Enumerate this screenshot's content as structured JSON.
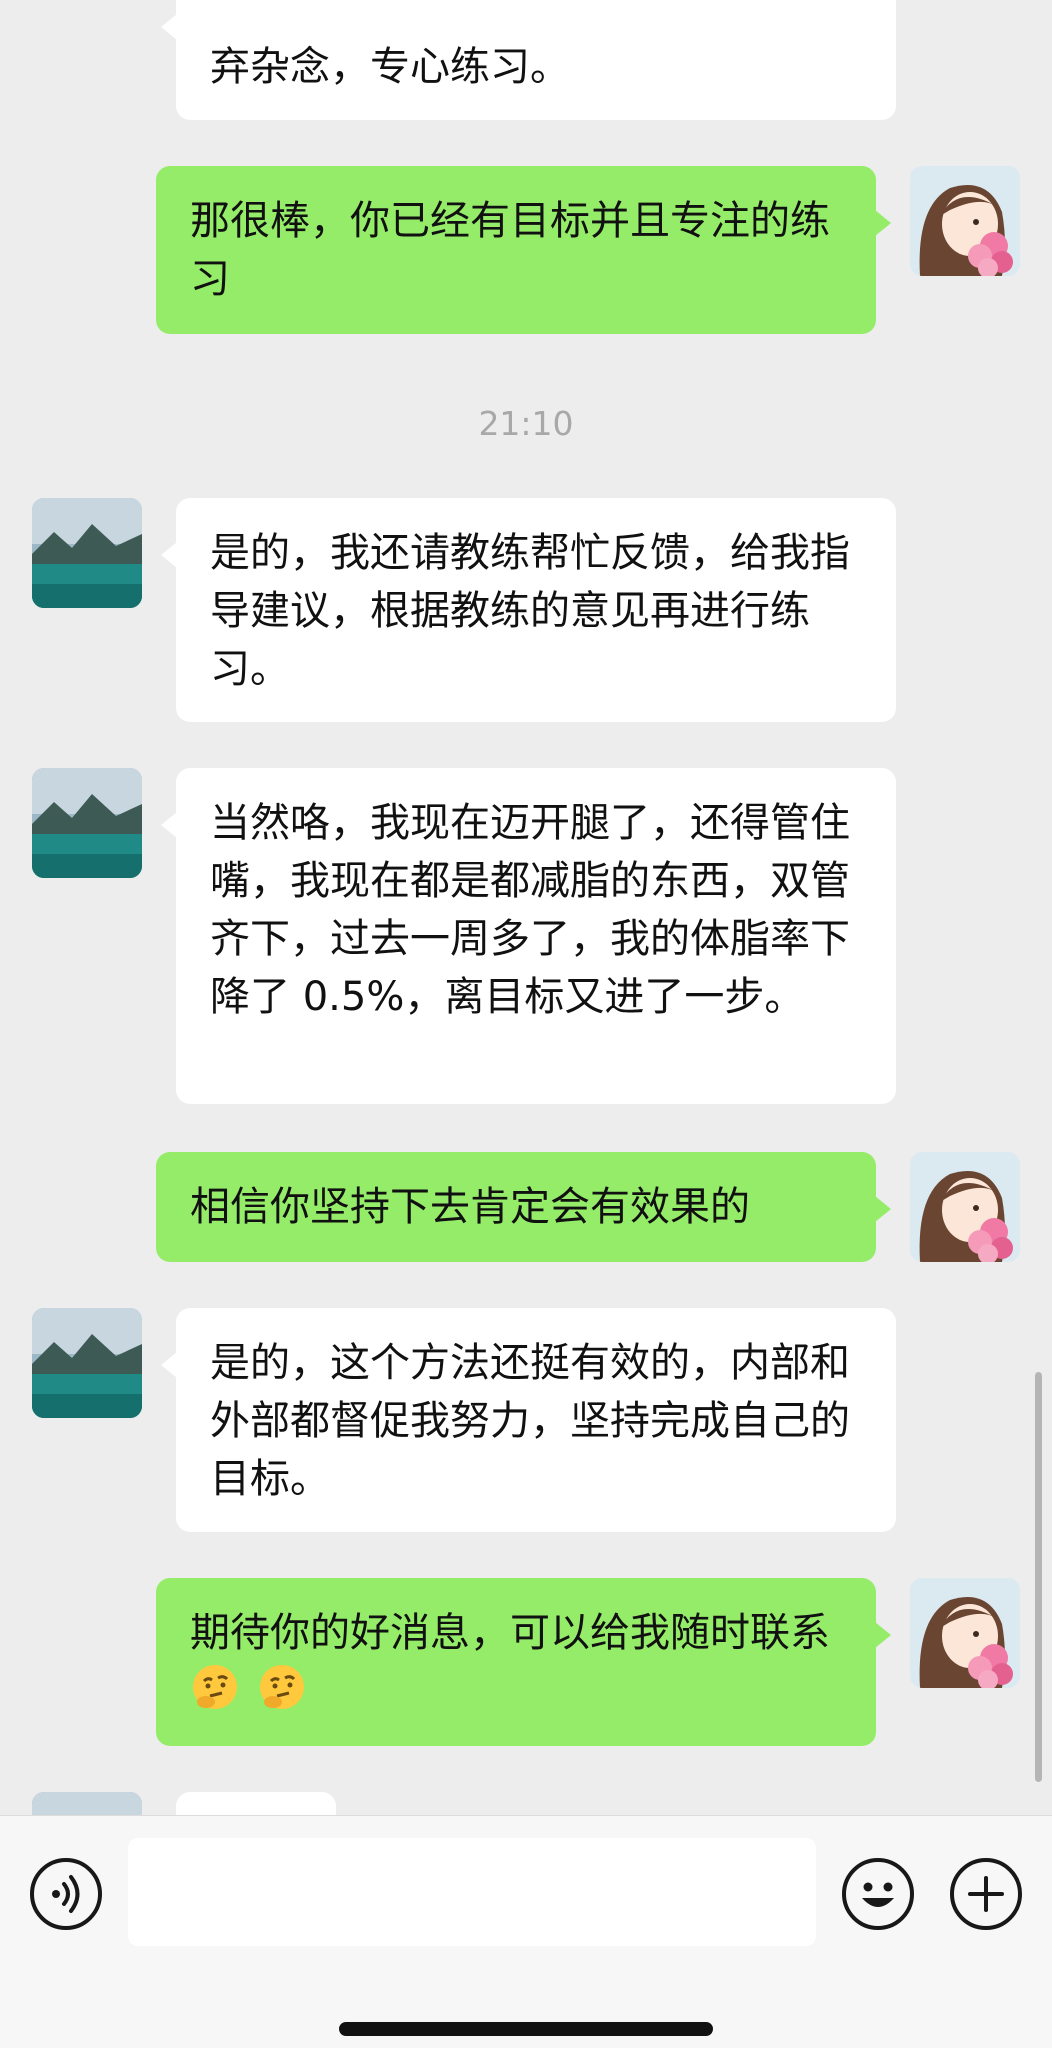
{
  "conversation": {
    "timestamp": "21:10",
    "messages": [
      {
        "id": "m1",
        "side": "left",
        "text": "弃杂念，专心练习。"
      },
      {
        "id": "m2",
        "side": "right",
        "text": "那很棒，你已经有目标并且专注的练习"
      },
      {
        "id": "m3",
        "side": "left",
        "text": "是的，我还请教练帮忙反馈，给我指导建议，根据教练的意见再进行练习。"
      },
      {
        "id": "m4",
        "side": "left",
        "text": "当然咯，我现在迈开腿了，还得管住嘴，我现在都是都减脂的东西，双管齐下，过去一周多了，我的体脂率下降了 0.5%，离目标又进了一步。"
      },
      {
        "id": "m5",
        "side": "right",
        "text": "相信你坚持下去肯定会有效果的"
      },
      {
        "id": "m6",
        "side": "left",
        "text": "是的，这个方法还挺有效的，内部和外部都督促我努力，坚持完成自己的目标。"
      },
      {
        "id": "m7",
        "side": "right",
        "text": "期待你的好消息，可以给我随时联系",
        "emoji": [
          "thinking-face",
          "thinking-face"
        ]
      }
    ]
  },
  "input_bar": {
    "voice_icon": "voice-icon",
    "emoji_icon": "smiley-icon",
    "plus_icon": "plus-icon",
    "input_value": ""
  },
  "colors": {
    "background": "#ededed",
    "own_bubble": "#95ec69",
    "other_bubble": "#ffffff",
    "timestamp": "#a8a8a8"
  }
}
